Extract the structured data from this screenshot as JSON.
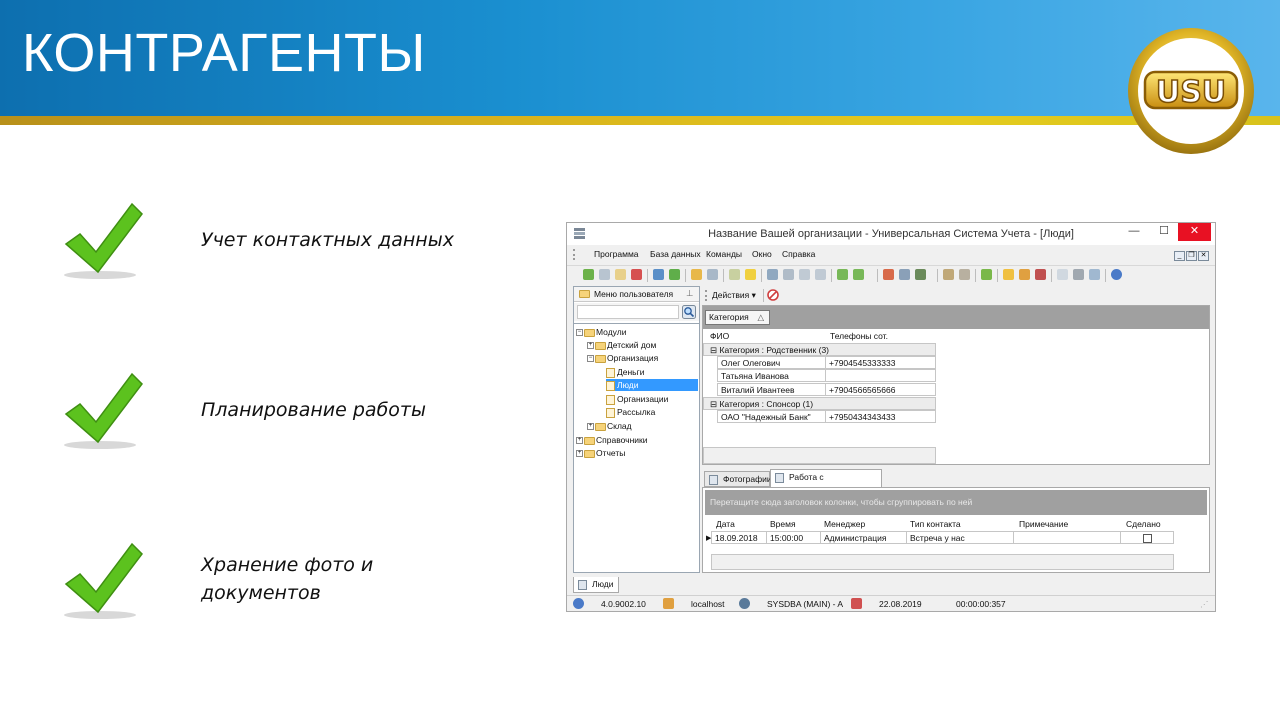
{
  "slide": {
    "title": "КОНТРАГЕНТЫ",
    "logo_text": "USU",
    "bullets": [
      {
        "line1": "Учет контактных данных",
        "line2": ""
      },
      {
        "line1": "Планирование работы",
        "line2": ""
      },
      {
        "line1": "Хранение фото и",
        "line2": "документов"
      }
    ]
  },
  "window": {
    "title": "Название Вашей организации - Универсальная Система Учета - [Люди]",
    "controls": {
      "minimize": "—",
      "maximize": "☐",
      "close": "✕"
    },
    "menu": [
      "Программа",
      "База данных",
      "Команды",
      "Окно",
      "Справка"
    ],
    "left_panel": {
      "header": "Меню пользователя",
      "tree": [
        {
          "label": "Модули",
          "type": "folder",
          "expander": "⊟"
        },
        {
          "label": "Детский дом",
          "type": "folder",
          "expander": "⊞"
        },
        {
          "label": "Организация",
          "type": "folder",
          "expander": "⊟"
        },
        {
          "label": "Деньги",
          "type": "page"
        },
        {
          "label": "Люди",
          "type": "page",
          "selected": true
        },
        {
          "label": "Организации",
          "type": "page"
        },
        {
          "label": "Рассылка",
          "type": "page"
        },
        {
          "label": "Склад",
          "type": "folder",
          "expander": "⊞"
        },
        {
          "label": "Справочники",
          "type": "folder",
          "expander": "⊞"
        },
        {
          "label": "Отчеты",
          "type": "folder",
          "expander": "⊞"
        }
      ]
    },
    "actions_label": "Действия",
    "grid": {
      "group_chip": "Категория",
      "columns": [
        "ФИО",
        "Телефоны сот."
      ],
      "groups": [
        {
          "label": "Категория : Родственник (3)",
          "rows": [
            {
              "name": "Олег Олегович",
              "phone": "+7904545333333"
            },
            {
              "name": "Татьяна Иванова",
              "phone": ""
            },
            {
              "name": "Виталий Ивантеев",
              "phone": "+7904566565666"
            }
          ]
        },
        {
          "label": "Категория : Спонсор (1)",
          "rows": [
            {
              "name": "ОАО \"Надежный Банк\"",
              "phone": "+7950434343433"
            }
          ]
        }
      ]
    },
    "detail_tabs": [
      "Фотографии",
      "Работа с контрагентом"
    ],
    "detail_grid": {
      "drag_hint": "Перетащите сюда заголовок колонки, чтобы сгруппировать по ней",
      "columns": [
        "Дата",
        "Время",
        "Менеджер",
        "Тип контакта",
        "Примечание",
        "Сделано"
      ],
      "row": {
        "date": "18.09.2018",
        "time": "15:00:00",
        "manager": "Администрация",
        "type": "Встреча у нас",
        "note": "",
        "done": "false"
      }
    },
    "bottom_tab": "Люди",
    "status": {
      "version": "4.0.9002.10",
      "host": "localhost",
      "user": "SYSDBA (MAIN) - A",
      "date": "22.08.2019",
      "timer": "00:00:00:357"
    }
  },
  "colors": {
    "header_blue_start": "#0d6faf",
    "header_blue_end": "#59b5ec",
    "gold_stripe": "#d8b21c",
    "check_green": "#5cc21e",
    "selection_blue": "#3399ff",
    "close_red": "#e81123"
  },
  "icons": [
    "check-icon",
    "usu-logo",
    "app-icon",
    "folder-icon",
    "page-icon",
    "search-icon",
    "info-icon",
    "database-icon",
    "user-icon",
    "calendar-icon",
    "pin-icon",
    "cancel-icon"
  ]
}
